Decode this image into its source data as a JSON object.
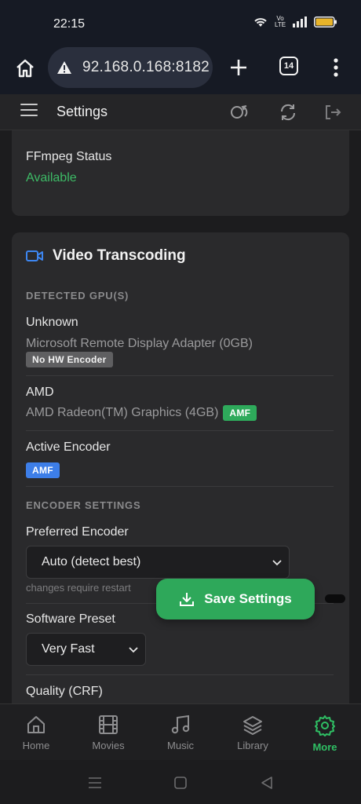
{
  "status_bar": {
    "time": "22:15",
    "icons": [
      "wifi-icon",
      "volte-icon",
      "signal-icon",
      "battery-icon"
    ],
    "volte_text": "Vo LTE"
  },
  "browser": {
    "url": "92.168.0.168:8182",
    "tab_count": "14",
    "icons": [
      "home-icon",
      "warning-icon",
      "plus-icon",
      "tabs-icon",
      "more-vert-icon"
    ]
  },
  "header": {
    "title": "Settings",
    "icons": [
      "menu-icon",
      "sync-icon",
      "refresh-icon",
      "logout-icon"
    ]
  },
  "ffmpeg": {
    "label": "FFmpeg Status",
    "value": "Available"
  },
  "video": {
    "title": "Video Transcoding",
    "detected_heading": "DETECTED GPU(S)",
    "gpus": [
      {
        "vendor": "Unknown",
        "name": "Microsoft Remote Display Adapter (0GB)",
        "badge": "No HW Encoder"
      },
      {
        "vendor": "AMD",
        "name": "AMD Radeon(TM) Graphics (4GB)",
        "badge": "AMF"
      }
    ],
    "active_encoder_label": "Active Encoder",
    "active_encoder_badge": "AMF",
    "encoder_settings_heading": "ENCODER SETTINGS",
    "preferred_label": "Preferred Encoder",
    "preferred_value": "Auto (detect best)",
    "preferred_hint": "changes require restart",
    "software_preset_label": "Software Preset",
    "software_preset_value": "Very Fast",
    "quality_label": "Quality (CRF)"
  },
  "save_button": {
    "label": "Save Settings"
  },
  "bottom_nav": {
    "items": [
      {
        "label": "Home",
        "icon": "home-icon"
      },
      {
        "label": "Movies",
        "icon": "film-icon"
      },
      {
        "label": "Music",
        "icon": "music-icon"
      },
      {
        "label": "Library",
        "icon": "layers-icon"
      },
      {
        "label": "More",
        "icon": "gear-icon",
        "active": true
      }
    ]
  },
  "colors": {
    "accent_green": "#2ea85a",
    "badge_blue": "#3d7ee8",
    "badge_gray": "#5f5f61",
    "background": "#1c1c1e",
    "card": "#2a2a2c"
  }
}
